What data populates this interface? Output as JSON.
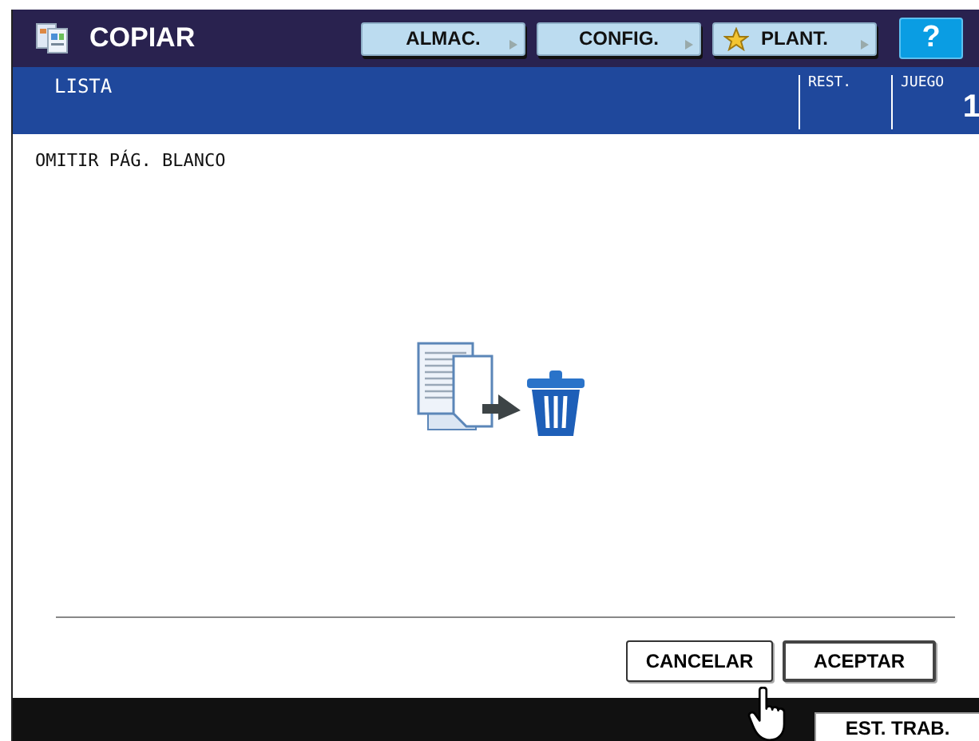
{
  "header": {
    "title": "COPIAR",
    "buttons": [
      {
        "label": "ALMAC.",
        "kind": "plain"
      },
      {
        "label": "CONFIG.",
        "kind": "plain"
      },
      {
        "label": "PLANT.",
        "kind": "star"
      }
    ],
    "help": "?"
  },
  "status": {
    "label": "LISTA",
    "rest_label": "REST.",
    "set_label": "JUEGO",
    "set_value": "1"
  },
  "body": {
    "heading": "OMITIR PÁG. BLANCO"
  },
  "actions": [
    {
      "label": "CANCELAR",
      "selected": false
    },
    {
      "label": "ACEPTAR",
      "selected": true
    }
  ],
  "footer": {
    "button": "EST. TRAB."
  }
}
